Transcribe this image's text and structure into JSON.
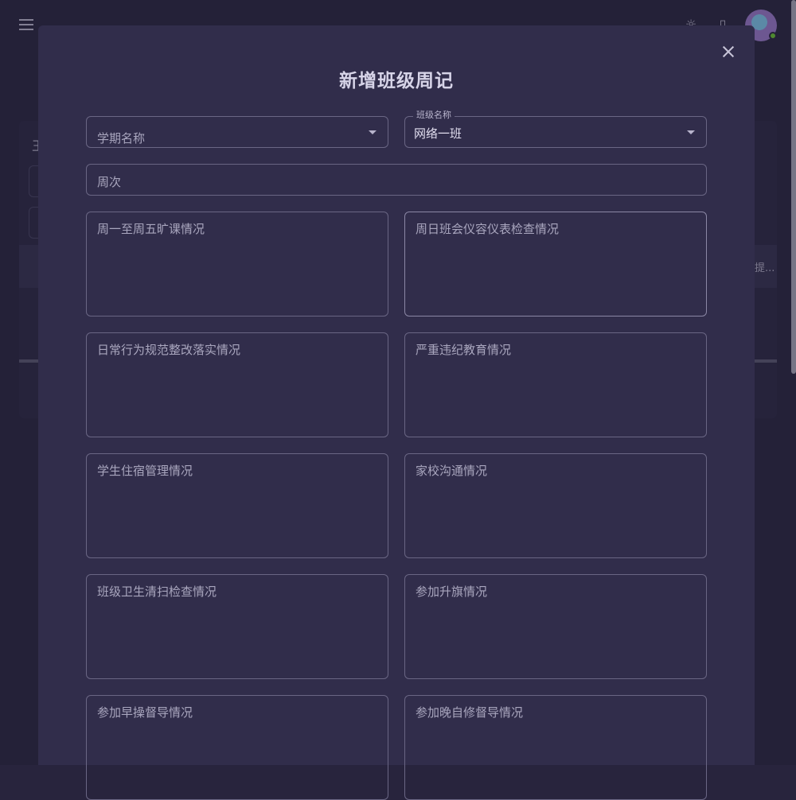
{
  "background": {
    "truncated_text_right": "提...",
    "truncated_text_left": "王"
  },
  "dialog": {
    "title": "新增班级周记",
    "close_icon": "close-icon"
  },
  "form": {
    "term_name": {
      "label": "学期名称",
      "value": ""
    },
    "class_name": {
      "label": "班级名称",
      "value": "网络一班"
    },
    "week": {
      "label": "周次",
      "value": ""
    },
    "textareas": [
      {
        "label": "周一至周五旷课情况"
      },
      {
        "label": "周日班会仪容仪表检查情况"
      },
      {
        "label": "日常行为规范整改落实情况"
      },
      {
        "label": "严重违纪教育情况"
      },
      {
        "label": "学生住宿管理情况"
      },
      {
        "label": "家校沟通情况"
      },
      {
        "label": "班级卫生清扫检查情况"
      },
      {
        "label": "参加升旗情况"
      },
      {
        "label": "参加早操督导情况"
      },
      {
        "label": "参加晚自修督导情况"
      }
    ]
  },
  "colors": {
    "background": "#28243D",
    "dialog": "#312D4B",
    "border": "#6A6684",
    "text": "#D7D4E8"
  }
}
